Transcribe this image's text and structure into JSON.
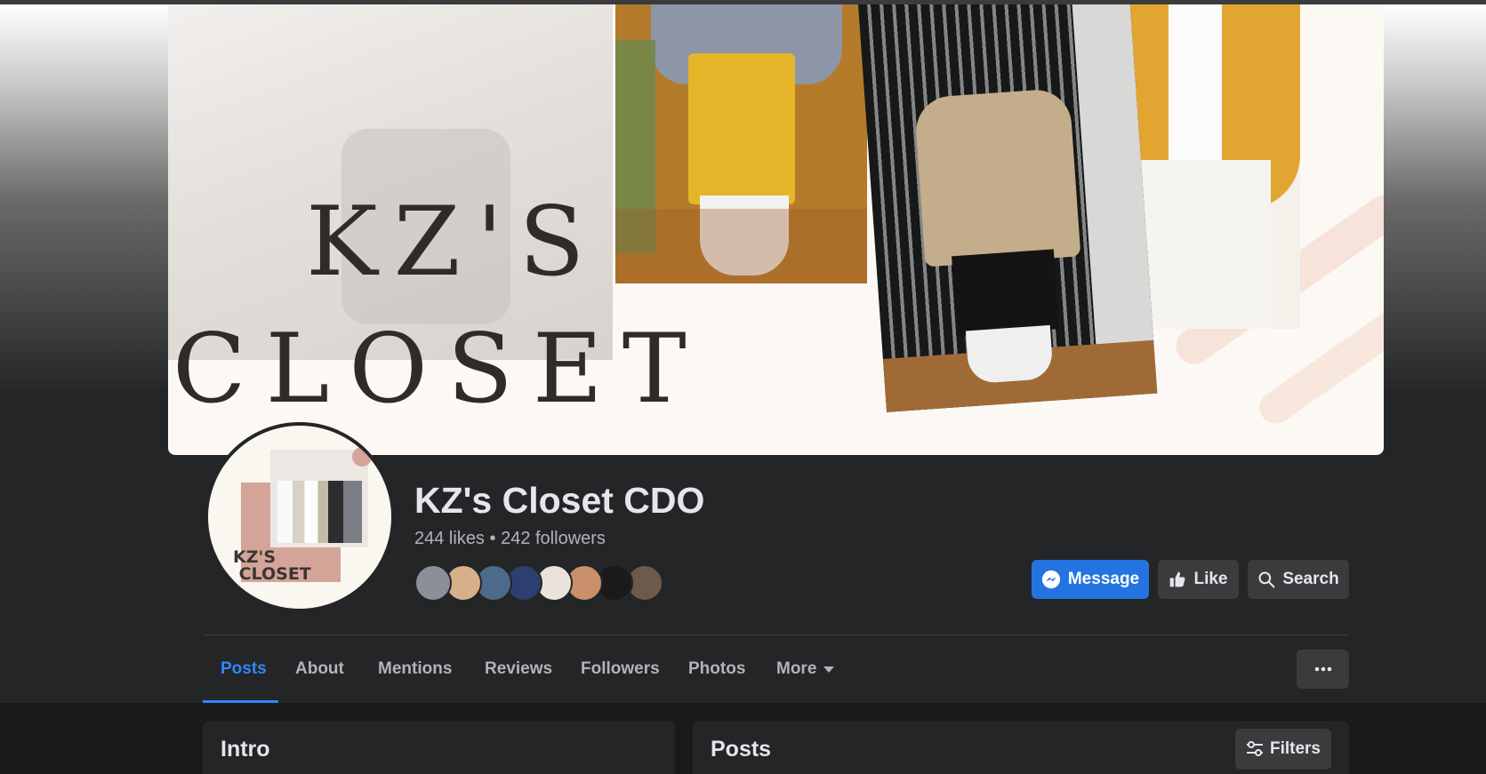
{
  "cover": {
    "title_line1": "KZ'S",
    "title_line2": "CLOSET"
  },
  "avatar": {
    "logo_text": "KZ'S\n CLOSET"
  },
  "page": {
    "name": "KZ's Closet CDO",
    "likes": "244 likes",
    "separator": "•",
    "followers": "242 followers",
    "follower_faces": [
      "#8a8f98",
      "#d6b08a",
      "#4d6a8a",
      "#2c3f6e",
      "#e9e3dc",
      "#c98f6b",
      "#1a1a1a",
      "#6d5a4a"
    ]
  },
  "actions": {
    "message_label": "Message",
    "like_label": "Like",
    "search_label": "Search"
  },
  "tabs": [
    {
      "label": "Posts",
      "active": true
    },
    {
      "label": "About"
    },
    {
      "label": "Mentions"
    },
    {
      "label": "Reviews"
    },
    {
      "label": "Followers"
    },
    {
      "label": "Photos"
    },
    {
      "label": "More"
    }
  ],
  "intro": {
    "title": "Intro"
  },
  "posts": {
    "title": "Posts",
    "filters_label": "Filters"
  },
  "colors": {
    "accent": "#2374e1",
    "tab_active": "#2d88ff",
    "background": "#18191a",
    "surface": "#242526"
  }
}
